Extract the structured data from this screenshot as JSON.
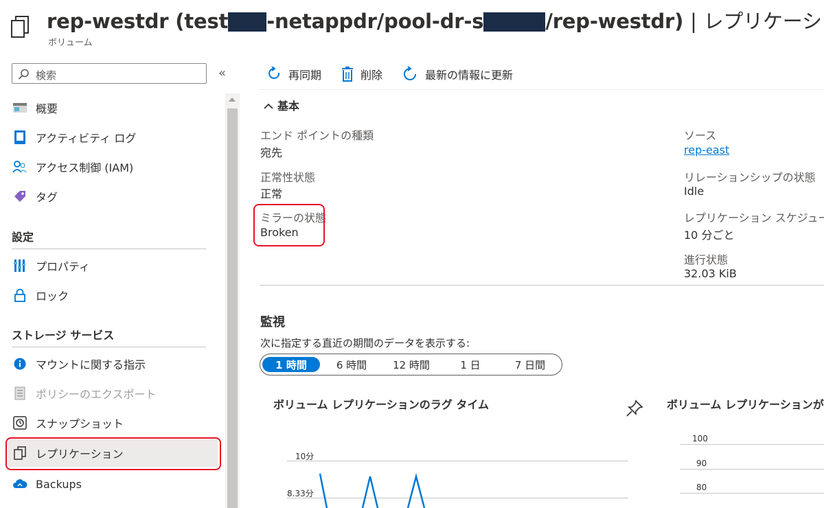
{
  "header": {
    "title_prefix": "rep-westdr (test",
    "title_mid": "-netappdr/pool-dr-s",
    "title_suffix": "/rep-westdr)",
    "title_separator": "|",
    "title_page": "レプリケーション",
    "subtitle": "ボリューム",
    "redaction_color": "#1b2c47"
  },
  "sidebar": {
    "search_placeholder": "検索",
    "collapse_label": "«",
    "items_top": [
      {
        "label": "概要",
        "icon": "overview-icon"
      },
      {
        "label": "アクティビティ ログ",
        "icon": "activity-log-icon"
      },
      {
        "label": "アクセス制御 (IAM)",
        "icon": "iam-icon"
      },
      {
        "label": "タグ",
        "icon": "tag-icon"
      }
    ],
    "section_settings": "設定",
    "items_settings": [
      {
        "label": "プロパティ",
        "icon": "properties-icon"
      },
      {
        "label": "ロック",
        "icon": "lock-icon"
      }
    ],
    "section_storage": "ストレージ サービス",
    "items_storage": [
      {
        "label": "マウントに関する指示",
        "icon": "info-icon"
      },
      {
        "label": "ポリシーのエクスポート",
        "icon": "export-policy-icon",
        "disabled": true
      },
      {
        "label": "スナップショット",
        "icon": "snapshot-icon"
      },
      {
        "label": "レプリケーション",
        "icon": "replication-icon",
        "selected": true
      },
      {
        "label": "Backups",
        "icon": "backups-icon"
      }
    ]
  },
  "toolbar": {
    "resync_label": "再同期",
    "delete_label": "削除",
    "refresh_label": "最新の情報に更新"
  },
  "essentials": {
    "heading": "基本",
    "left": [
      {
        "label": "エンド ポイントの種類",
        "value": "宛先"
      },
      {
        "label": "正常性状態",
        "value": "正常"
      },
      {
        "label": "ミラーの状態",
        "value": "Broken"
      }
    ],
    "right": [
      {
        "label": "ソース",
        "value": "rep-east"
      },
      {
        "label": "リレーションシップの状態",
        "value": "Idle"
      },
      {
        "label": "レプリケーション スケジュール",
        "value": "10 分ごと"
      },
      {
        "label": "進行状態",
        "value": "32.03 KiB"
      }
    ]
  },
  "monitoring": {
    "heading": "監視",
    "subtitle": "次に指定する直近の期間のデータを表示する:",
    "time_ranges": [
      "1 時間",
      "6 時間",
      "12 時間",
      "1 日",
      "7 日間"
    ],
    "selected_range": "1 時間",
    "chart1_title": "ボリューム レプリケーションのラグ タイム",
    "chart2_title": "ボリューム レプリケーションが転送",
    "chart1_ticks": [
      "10分",
      "8.33分"
    ],
    "chart2_ticks": [
      "100",
      "90",
      "80"
    ]
  },
  "colors": {
    "accent": "#0078d4",
    "highlight_border": "#e81123",
    "chart_line": "#0078d4"
  }
}
